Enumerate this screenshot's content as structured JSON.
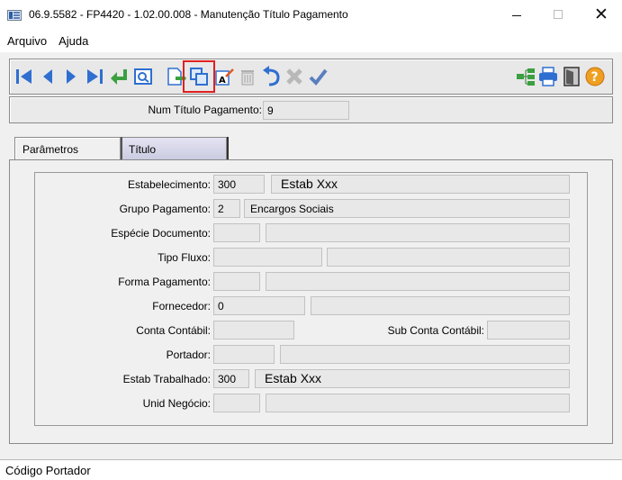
{
  "window": {
    "title": "06.9.5582 - FP4420 - 1.02.00.008 - Manutenção Título Pagamento",
    "min_glyph": "—",
    "close_glyph": "✕"
  },
  "menu": {
    "items": [
      "Arquivo",
      "Ajuda"
    ]
  },
  "toolbar": {
    "icons": [
      "first-record-icon",
      "previous-record-icon",
      "next-record-icon",
      "last-record-icon",
      "goto-icon",
      "search-icon",
      "add-icon",
      "copy-icon",
      "edit-icon",
      "delete-icon",
      "undo-icon",
      "cancel-icon",
      "save-icon",
      "navigation-icon",
      "print-icon",
      "exit-icon",
      "help-icon"
    ],
    "highlighted": "copy-icon",
    "highlight_color": "#e02020"
  },
  "key": {
    "label": "Num Título Pagamento:",
    "value": "9"
  },
  "tabs": [
    {
      "label": "Parâmetros",
      "active": true
    },
    {
      "label": "Título",
      "active": false
    }
  ],
  "form": {
    "estabelecimento": {
      "label": "Estabelecimento:",
      "code": "300",
      "desc": "Estab Xxx"
    },
    "grupo_pagamento": {
      "label": "Grupo Pagamento:",
      "code": "2",
      "desc": "Encargos Sociais"
    },
    "especie_documento": {
      "label": "Espécie Documento:",
      "code": "",
      "desc": ""
    },
    "tipo_fluxo": {
      "label": "Tipo Fluxo:",
      "code": "",
      "desc": ""
    },
    "forma_pagamento": {
      "label": "Forma Pagamento:",
      "code": "",
      "desc": ""
    },
    "fornecedor": {
      "label": "Fornecedor:",
      "code": "0",
      "desc": ""
    },
    "conta_contabil": {
      "label": "Conta Contábil:",
      "value": ""
    },
    "sub_conta_contabil": {
      "label": "Sub Conta Contábil:",
      "value": ""
    },
    "portador": {
      "label": "Portador:",
      "code": "",
      "desc": ""
    },
    "estab_trabalhado": {
      "label": "Estab Trabalhado:",
      "code": "300",
      "desc": "Estab Xxx"
    },
    "unid_negocio": {
      "label": "Unid Negócio:",
      "code": "",
      "desc": ""
    }
  },
  "status": {
    "text": "Código Portador"
  }
}
